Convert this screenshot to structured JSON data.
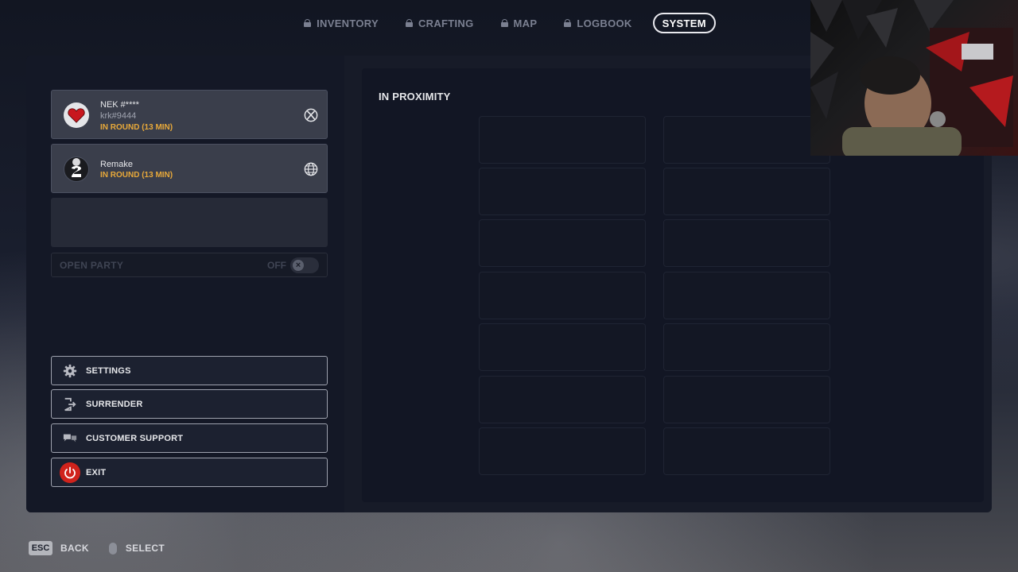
{
  "nav": {
    "tabs": [
      {
        "label": "INVENTORY",
        "locked": true
      },
      {
        "label": "CRAFTING",
        "locked": true
      },
      {
        "label": "MAP",
        "locked": true
      },
      {
        "label": "LOGBOOK",
        "locked": true
      },
      {
        "label": "SYSTEM",
        "locked": false,
        "active": true
      }
    ]
  },
  "party": {
    "members": [
      {
        "name": "NEK #****",
        "tag": "krk#9444",
        "status": "IN ROUND (13 MIN)",
        "platform_icon": "xbox-icon"
      },
      {
        "name": "Remake",
        "status": "IN ROUND (13 MIN)",
        "platform_icon": "globe-icon"
      }
    ],
    "open_party": {
      "label": "OPEN PARTY",
      "state": "OFF"
    }
  },
  "menu": {
    "settings": "SETTINGS",
    "surrender": "SURRENDER",
    "support": "CUSTOMER SUPPORT",
    "exit": "EXIT"
  },
  "proximity": {
    "title": "IN PROXIMITY"
  },
  "footer": {
    "esc_key": "ESC",
    "back": "BACK",
    "select": "SELECT"
  },
  "colors": {
    "status": "#e8a93a",
    "exit": "#d0231c",
    "accent": "#ffffff"
  }
}
